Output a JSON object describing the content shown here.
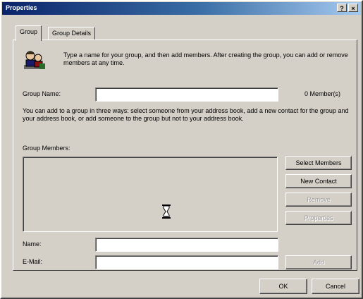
{
  "window": {
    "title": "Properties",
    "help_glyph": "?",
    "close_glyph": "×"
  },
  "tabs": [
    {
      "label": "Group"
    },
    {
      "label": "Group Details"
    }
  ],
  "intro_text": "Type a name for your group, and then add members. After creating the group, you can add or remove members at any time.",
  "group_name": {
    "label": "Group Name:",
    "value": "",
    "member_count": "0 Member(s)"
  },
  "instructions": "You can add to a group in three ways: select someone from your address book, add a new contact for the group and your address book, or add someone to the group but not to your address book.",
  "members": {
    "label": "Group Members:",
    "items": []
  },
  "side_buttons": {
    "select_members": "Select Members",
    "new_contact": "New Contact",
    "remove": "Remove",
    "properties": "Properties"
  },
  "contact": {
    "name_label": "Name:",
    "name_value": "",
    "email_label": "E-Mail:",
    "email_value": "",
    "add_label": "Add"
  },
  "footer": {
    "ok_label": "OK",
    "cancel_label": "Cancel"
  },
  "icons": [
    "people-icon",
    "hourglass-icon"
  ]
}
